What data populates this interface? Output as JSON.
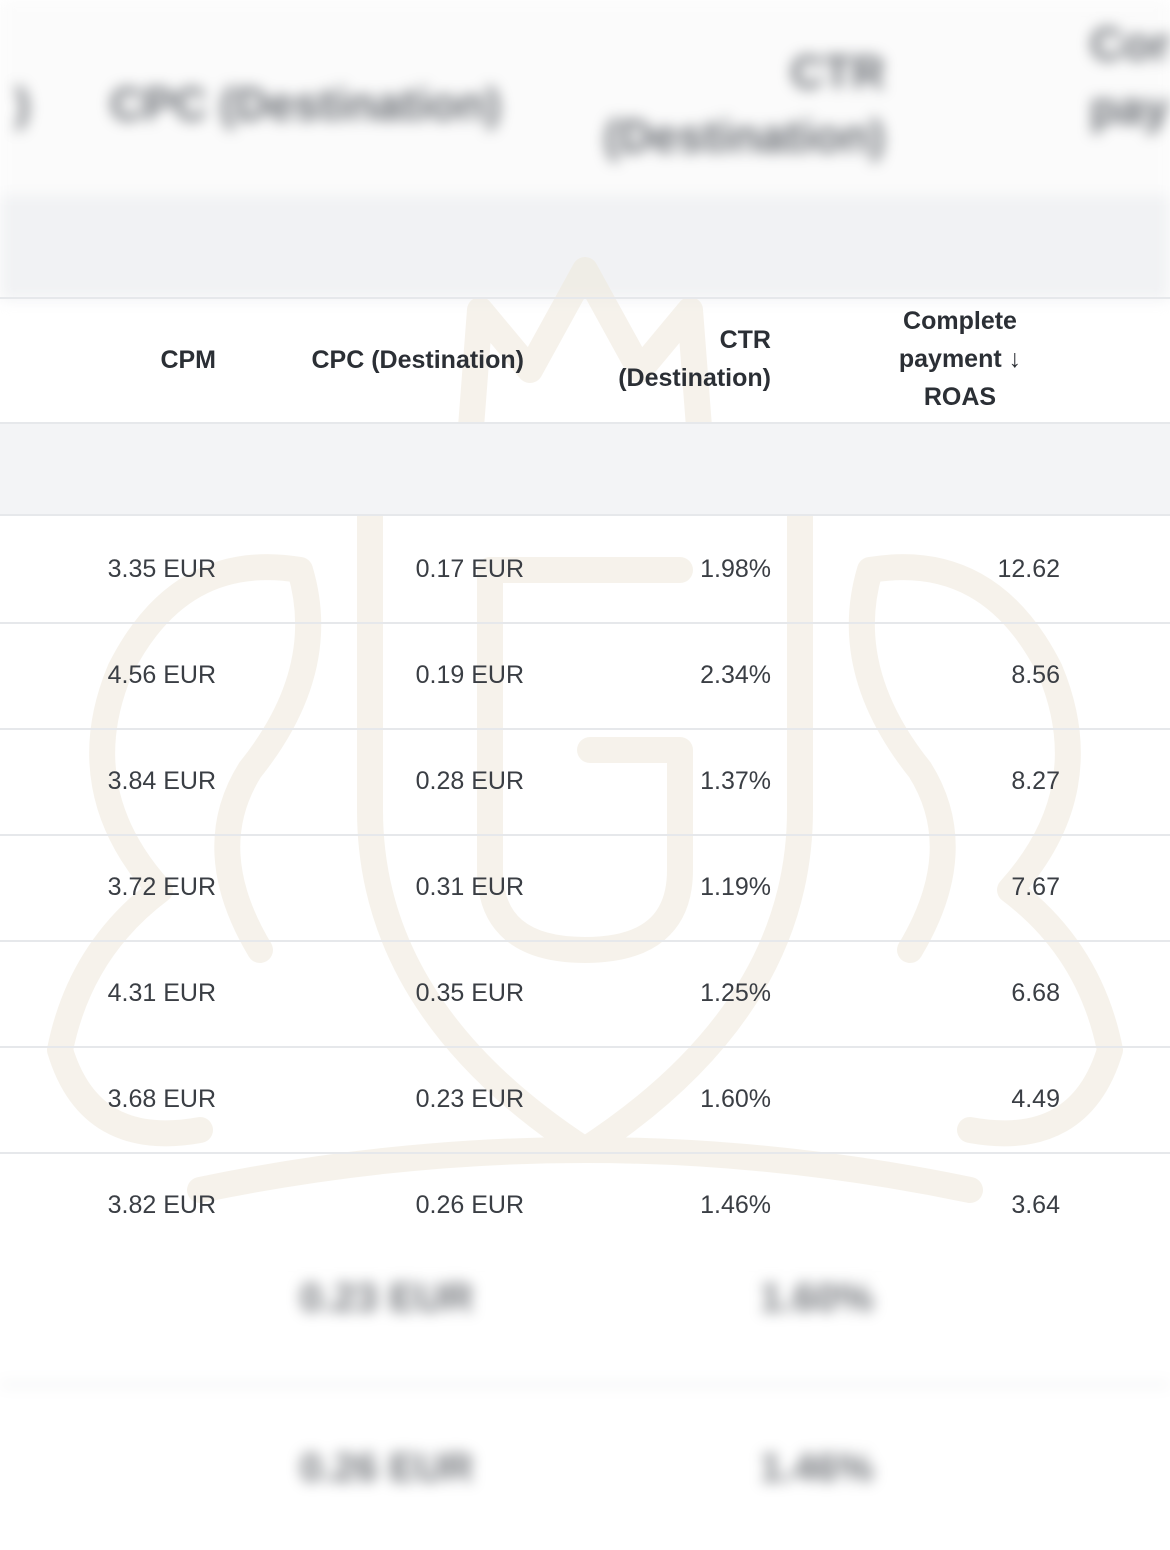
{
  "columns": {
    "cpm": "CPM",
    "cpc": "CPC (Destination)",
    "ctr_line1": "CTR",
    "ctr_line2": "(Destination)",
    "roas_line1": "Complete",
    "roas_line2": "payment ↓",
    "roas_line3": "ROAS"
  },
  "rows": [
    {
      "cpm": "3.35 EUR",
      "cpc": "0.17 EUR",
      "ctr": "1.98%",
      "roas": "12.62"
    },
    {
      "cpm": "4.56 EUR",
      "cpc": "0.19 EUR",
      "ctr": "2.34%",
      "roas": "8.56"
    },
    {
      "cpm": "3.84 EUR",
      "cpc": "0.28 EUR",
      "ctr": "1.37%",
      "roas": "8.27"
    },
    {
      "cpm": "3.72 EUR",
      "cpc": "0.31 EUR",
      "ctr": "1.19%",
      "roas": "7.67"
    },
    {
      "cpm": "4.31 EUR",
      "cpc": "0.35 EUR",
      "ctr": "1.25%",
      "roas": "6.68"
    },
    {
      "cpm": "3.68 EUR",
      "cpc": "0.23 EUR",
      "ctr": "1.60%",
      "roas": "4.49"
    },
    {
      "cpm": "3.82 EUR",
      "cpc": "0.26 EUR",
      "ctr": "1.46%",
      "roas": "3.64"
    }
  ],
  "colors": {
    "header_text": "#2b2f35",
    "cell_text": "#3a3e44",
    "divider": "#e6e8eb",
    "group_band": "#f3f4f6"
  }
}
